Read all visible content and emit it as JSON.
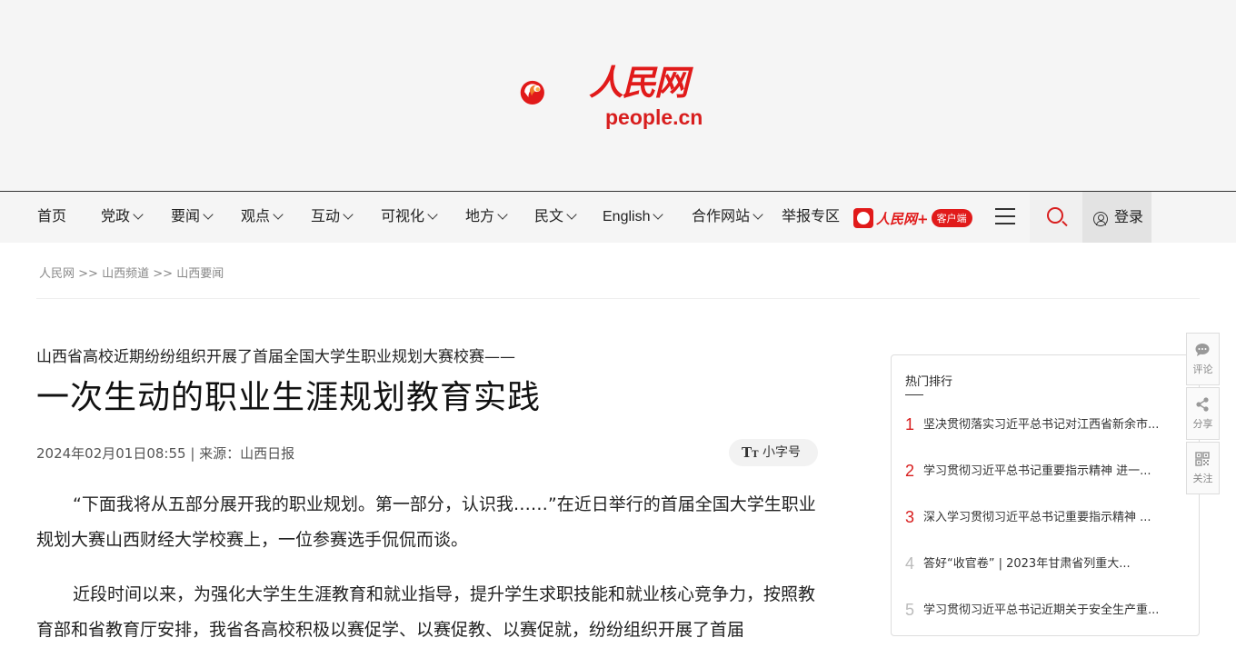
{
  "brand": {
    "logo_word": "人民网",
    "logo_domain": "people.cn",
    "colors": {
      "primary": "#e11a1a",
      "accent": "#f07c28"
    }
  },
  "nav": {
    "items": [
      {
        "label": "首页",
        "has_dropdown": false
      },
      {
        "label": "党政",
        "has_dropdown": true
      },
      {
        "label": "要闻",
        "has_dropdown": true
      },
      {
        "label": "观点",
        "has_dropdown": true
      },
      {
        "label": "互动",
        "has_dropdown": true
      },
      {
        "label": "可视化",
        "has_dropdown": true
      },
      {
        "label": "地方",
        "has_dropdown": true
      },
      {
        "label": "民文",
        "has_dropdown": true
      },
      {
        "label": "English",
        "has_dropdown": true
      },
      {
        "label": "合作网站",
        "has_dropdown": true
      },
      {
        "label": "举报专区",
        "has_dropdown": false
      }
    ],
    "app_badge": {
      "word": "人民网+",
      "pill": "客户端"
    },
    "menu_icon": "hamburger-icon",
    "search_icon": "search-icon",
    "login_label": "登录"
  },
  "breadcrumb": {
    "items": [
      "人民网",
      "山西频道",
      "山西要闻"
    ],
    "separator": ">>"
  },
  "article": {
    "kicker": "山西省高校近期纷纷组织开展了首届全国大学生职业规划大赛校赛——",
    "title": "一次生动的职业生涯规划教育实践",
    "meta": "2024年02月01日08:55 | 来源：山西日报",
    "font_toggle_label": "小字号",
    "paragraphs": [
      "“下面我将从五部分展开我的职业规划。第一部分，认识我……”在近日举行的首届全国大学生职业规划大赛山西财经大学校赛上，一位参赛选手侃侃而谈。",
      "近段时间以来，为强化大学生生涯教育和就业指导，提升学生求职技能和就业核心竞争力，按照教育部和省教育厅安排，我省各高校积极以赛促学、以赛促教、以赛促就，纷纷组织开展了首届"
    ]
  },
  "hot": {
    "title": "热门排行",
    "items": [
      {
        "rank": "1",
        "text": "坚决贯彻落实习近平总书记对江西省新余市..."
      },
      {
        "rank": "2",
        "text": "学习贯彻习近平总书记重要指示精神 进一..."
      },
      {
        "rank": "3",
        "text": "深入学习贯彻习近平总书记重要指示精神 ..."
      },
      {
        "rank": "4",
        "text": "答好“收官卷” | 2023年甘肃省列重大..."
      },
      {
        "rank": "5",
        "text": "学习贯彻习近平总书记近期关于安全生产重..."
      }
    ]
  },
  "side_tools": [
    {
      "label": "评论",
      "icon": "comment-icon"
    },
    {
      "label": "分享",
      "icon": "share-icon"
    },
    {
      "label": "关注",
      "icon": "qrcode-icon"
    }
  ]
}
